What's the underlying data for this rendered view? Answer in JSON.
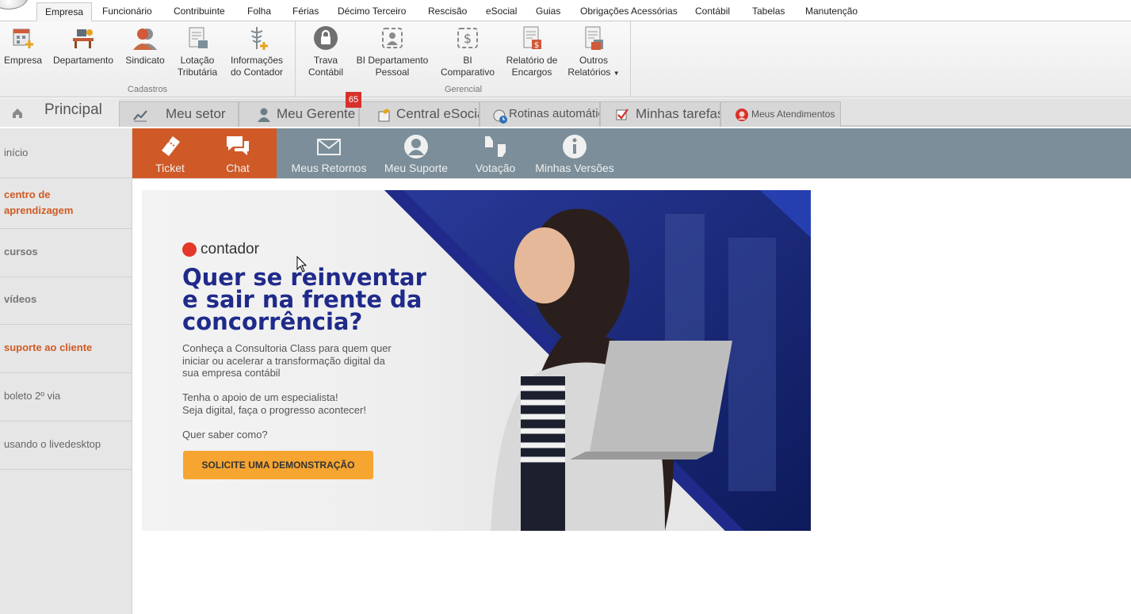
{
  "menubar": {
    "tabs": [
      "Empresa",
      "Funcionário",
      "Contribuinte",
      "Folha",
      "Férias",
      "Décimo Terceiro",
      "Rescisão",
      "eSocial",
      "Guias",
      "Obrigações Acessórias",
      "Contábil",
      "Tabelas",
      "Manutenção"
    ],
    "active": "Empresa"
  },
  "ribbon": {
    "cadastros": {
      "caption": "Cadastros",
      "buttons": [
        {
          "label": "Empresa",
          "icon": "building-add-icon"
        },
        {
          "label": "Departamento",
          "icon": "desk-icon"
        },
        {
          "label": "Sindicato",
          "icon": "people-icon"
        },
        {
          "label1": "Lotação",
          "label2": "Tributária",
          "icon": "document-add-icon"
        },
        {
          "label1": "Informações",
          "label2": "do Contador",
          "icon": "caduceus-icon"
        }
      ]
    },
    "gerencial": {
      "caption": "Gerencial",
      "buttons": [
        {
          "label1": "Trava",
          "label2": "Contábil",
          "icon": "lock-icon"
        },
        {
          "label1": "BI Departamento",
          "label2": "Pessoal",
          "icon": "bi-person-icon"
        },
        {
          "label1": "BI",
          "label2": "Comparativo",
          "icon": "bi-dollar-icon"
        },
        {
          "label1": "Relatório de",
          "label2": "Encargos",
          "icon": "report-dollar-icon"
        },
        {
          "label1": "Outros",
          "label2": "Relatórios",
          "icon": "report-list-icon"
        }
      ]
    }
  },
  "tabstrip": {
    "home": "Principal",
    "tabs": [
      "Meu setor",
      "Meu Gerente",
      "Central eSocial",
      "Rotinas automáticas",
      "Minhas tarefas",
      "Meus Atendimentos"
    ],
    "badge": "65"
  },
  "sidebar": {
    "items": [
      "início",
      "centro de aprendizagem",
      "cursos",
      "vídeos",
      "suporte ao cliente",
      "boleto 2º via",
      "usando o livedesktop"
    ]
  },
  "actionbar": {
    "buttons": [
      "Ticket",
      "Chat",
      "Meus Retornos",
      "Meu Suporte",
      "Votação",
      "Minhas Versões"
    ]
  },
  "banner": {
    "brand": "contador",
    "headline": "Quer se reinventar e sair na frente da concorrência?",
    "paragraph1_line1": "Conheça a Consultoria Class para quem quer",
    "paragraph1_line2": "iniciar ou acelerar a transformação digital da",
    "paragraph1_line3": "sua empresa contábil",
    "paragraph2_line1": "Tenha o apoio de um especialista!",
    "paragraph2_line2": "Seja digital, faça o progresso acontecer!",
    "paragraph3": "Quer saber como?",
    "cta": "SOLICITE UMA DEMONSTRAÇÃO"
  },
  "colors": {
    "accent_orange": "#cf5a28",
    "actionbar_gray": "#7b8e99",
    "headline_blue": "#1f2a8a",
    "cta_yellow": "#f6a531",
    "badge_red": "#d7312c"
  }
}
